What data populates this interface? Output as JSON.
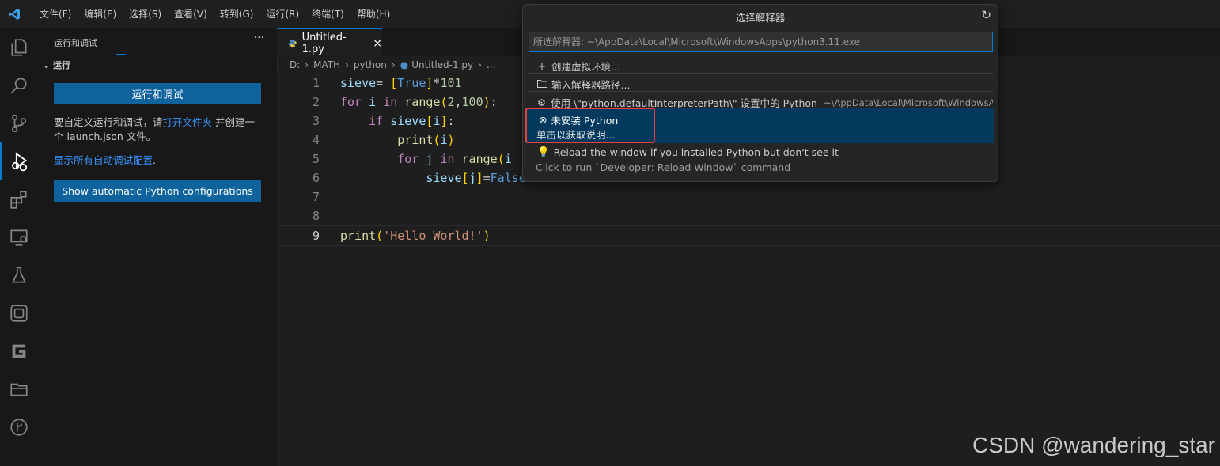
{
  "menu": [
    "文件(F)",
    "编辑(E)",
    "选择(S)",
    "查看(V)",
    "转到(G)",
    "运行(R)",
    "终端(T)",
    "帮助(H)"
  ],
  "sidebar": {
    "title": "运行和调试",
    "more": "···",
    "section": "运行",
    "run_button": "运行和调试",
    "text_prefix": "要自定义运行和调试，请",
    "text_link": "打开文件夹",
    "text_suffix": " 并创建一个 launch.json 文件。",
    "show_all_link": "显示所有自动调试配置",
    "show_all_suffix": ".",
    "python_button": "Show automatic Python configurations"
  },
  "tab": {
    "label": "Untitled-1.py",
    "close": "×"
  },
  "breadcrumb": [
    "D:",
    "MATH",
    "python",
    "Untitled-1.py",
    "..."
  ],
  "code_lines": [
    {
      "n": "1"
    },
    {
      "n": "2"
    },
    {
      "n": "3"
    },
    {
      "n": "4"
    },
    {
      "n": "5"
    },
    {
      "n": "6"
    },
    {
      "n": "7"
    },
    {
      "n": "8"
    },
    {
      "n": "9"
    }
  ],
  "quickpick": {
    "title": "选择解释器",
    "refresh": "↻",
    "input_value": "所选解释器: ~\\AppData\\Local\\Microsoft\\WindowsApps\\python3.11.exe",
    "items": [
      {
        "label": "创建虚拟环境...",
        "icon": "plus-icon"
      },
      {
        "label": "输入解释器路径...",
        "icon": "folder-icon"
      },
      {
        "label": "使用 \\\"python.defaultInterpreterPath\\\" 设置中的 Python",
        "desc": "~\\AppData\\Local\\Microsoft\\WindowsA...",
        "icon": "gear-icon"
      }
    ],
    "selected": {
      "label": "未安装 Python",
      "sub": "单击以获取说明..."
    },
    "reload": {
      "label": "Reload the window if you installed Python but don't see it",
      "sub": "Click to run `Developer: Reload Window` command"
    }
  },
  "watermark": "CSDN @wandering_star",
  "colors": {
    "accent": "#0078d4",
    "button": "#0e639c",
    "highlight": "#e9413a",
    "selected_bg": "#04395e"
  }
}
